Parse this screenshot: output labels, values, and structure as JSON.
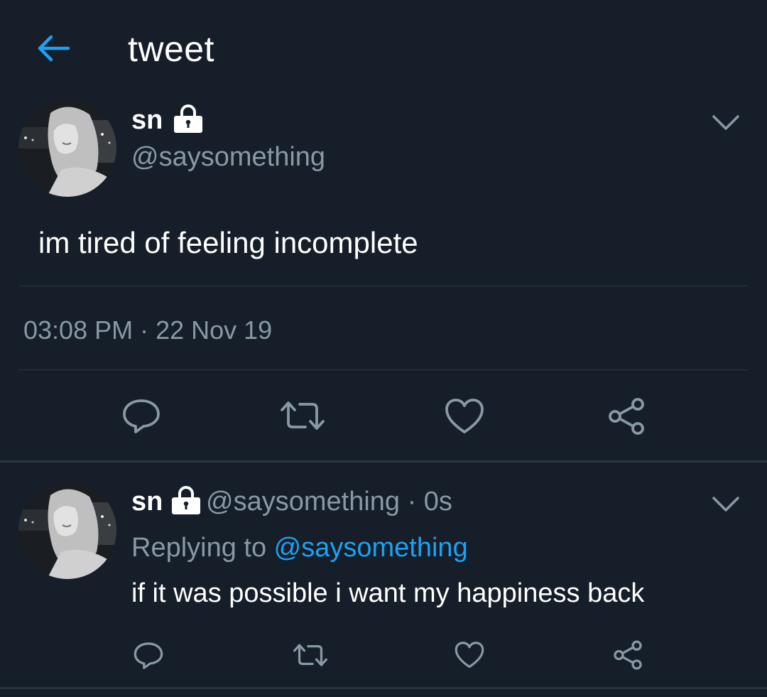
{
  "header": {
    "title": "tweet"
  },
  "main_tweet": {
    "display_name": "sn",
    "handle": "@saysomething",
    "text": "im tired of feeling incomplete",
    "timestamp": "03:08 PM · 22 Nov 19"
  },
  "reply": {
    "display_name": "sn",
    "handle_time": "@saysomething · 0s",
    "replying_prefix": "Replying to ",
    "replying_to": "@saysomething",
    "text": "if it was possible i want my happiness back"
  },
  "icons": {
    "back": "arrow-left-icon",
    "lock": "lock-icon",
    "menu": "chevron-down-icon",
    "reply": "speech-bubble-icon",
    "retweet": "retweet-icon",
    "like": "heart-icon",
    "share": "share-icon"
  },
  "colors": {
    "background": "#151e29",
    "accent": "#1da1f2",
    "secondary_text": "#8899a6",
    "divider": "#2c3845"
  }
}
